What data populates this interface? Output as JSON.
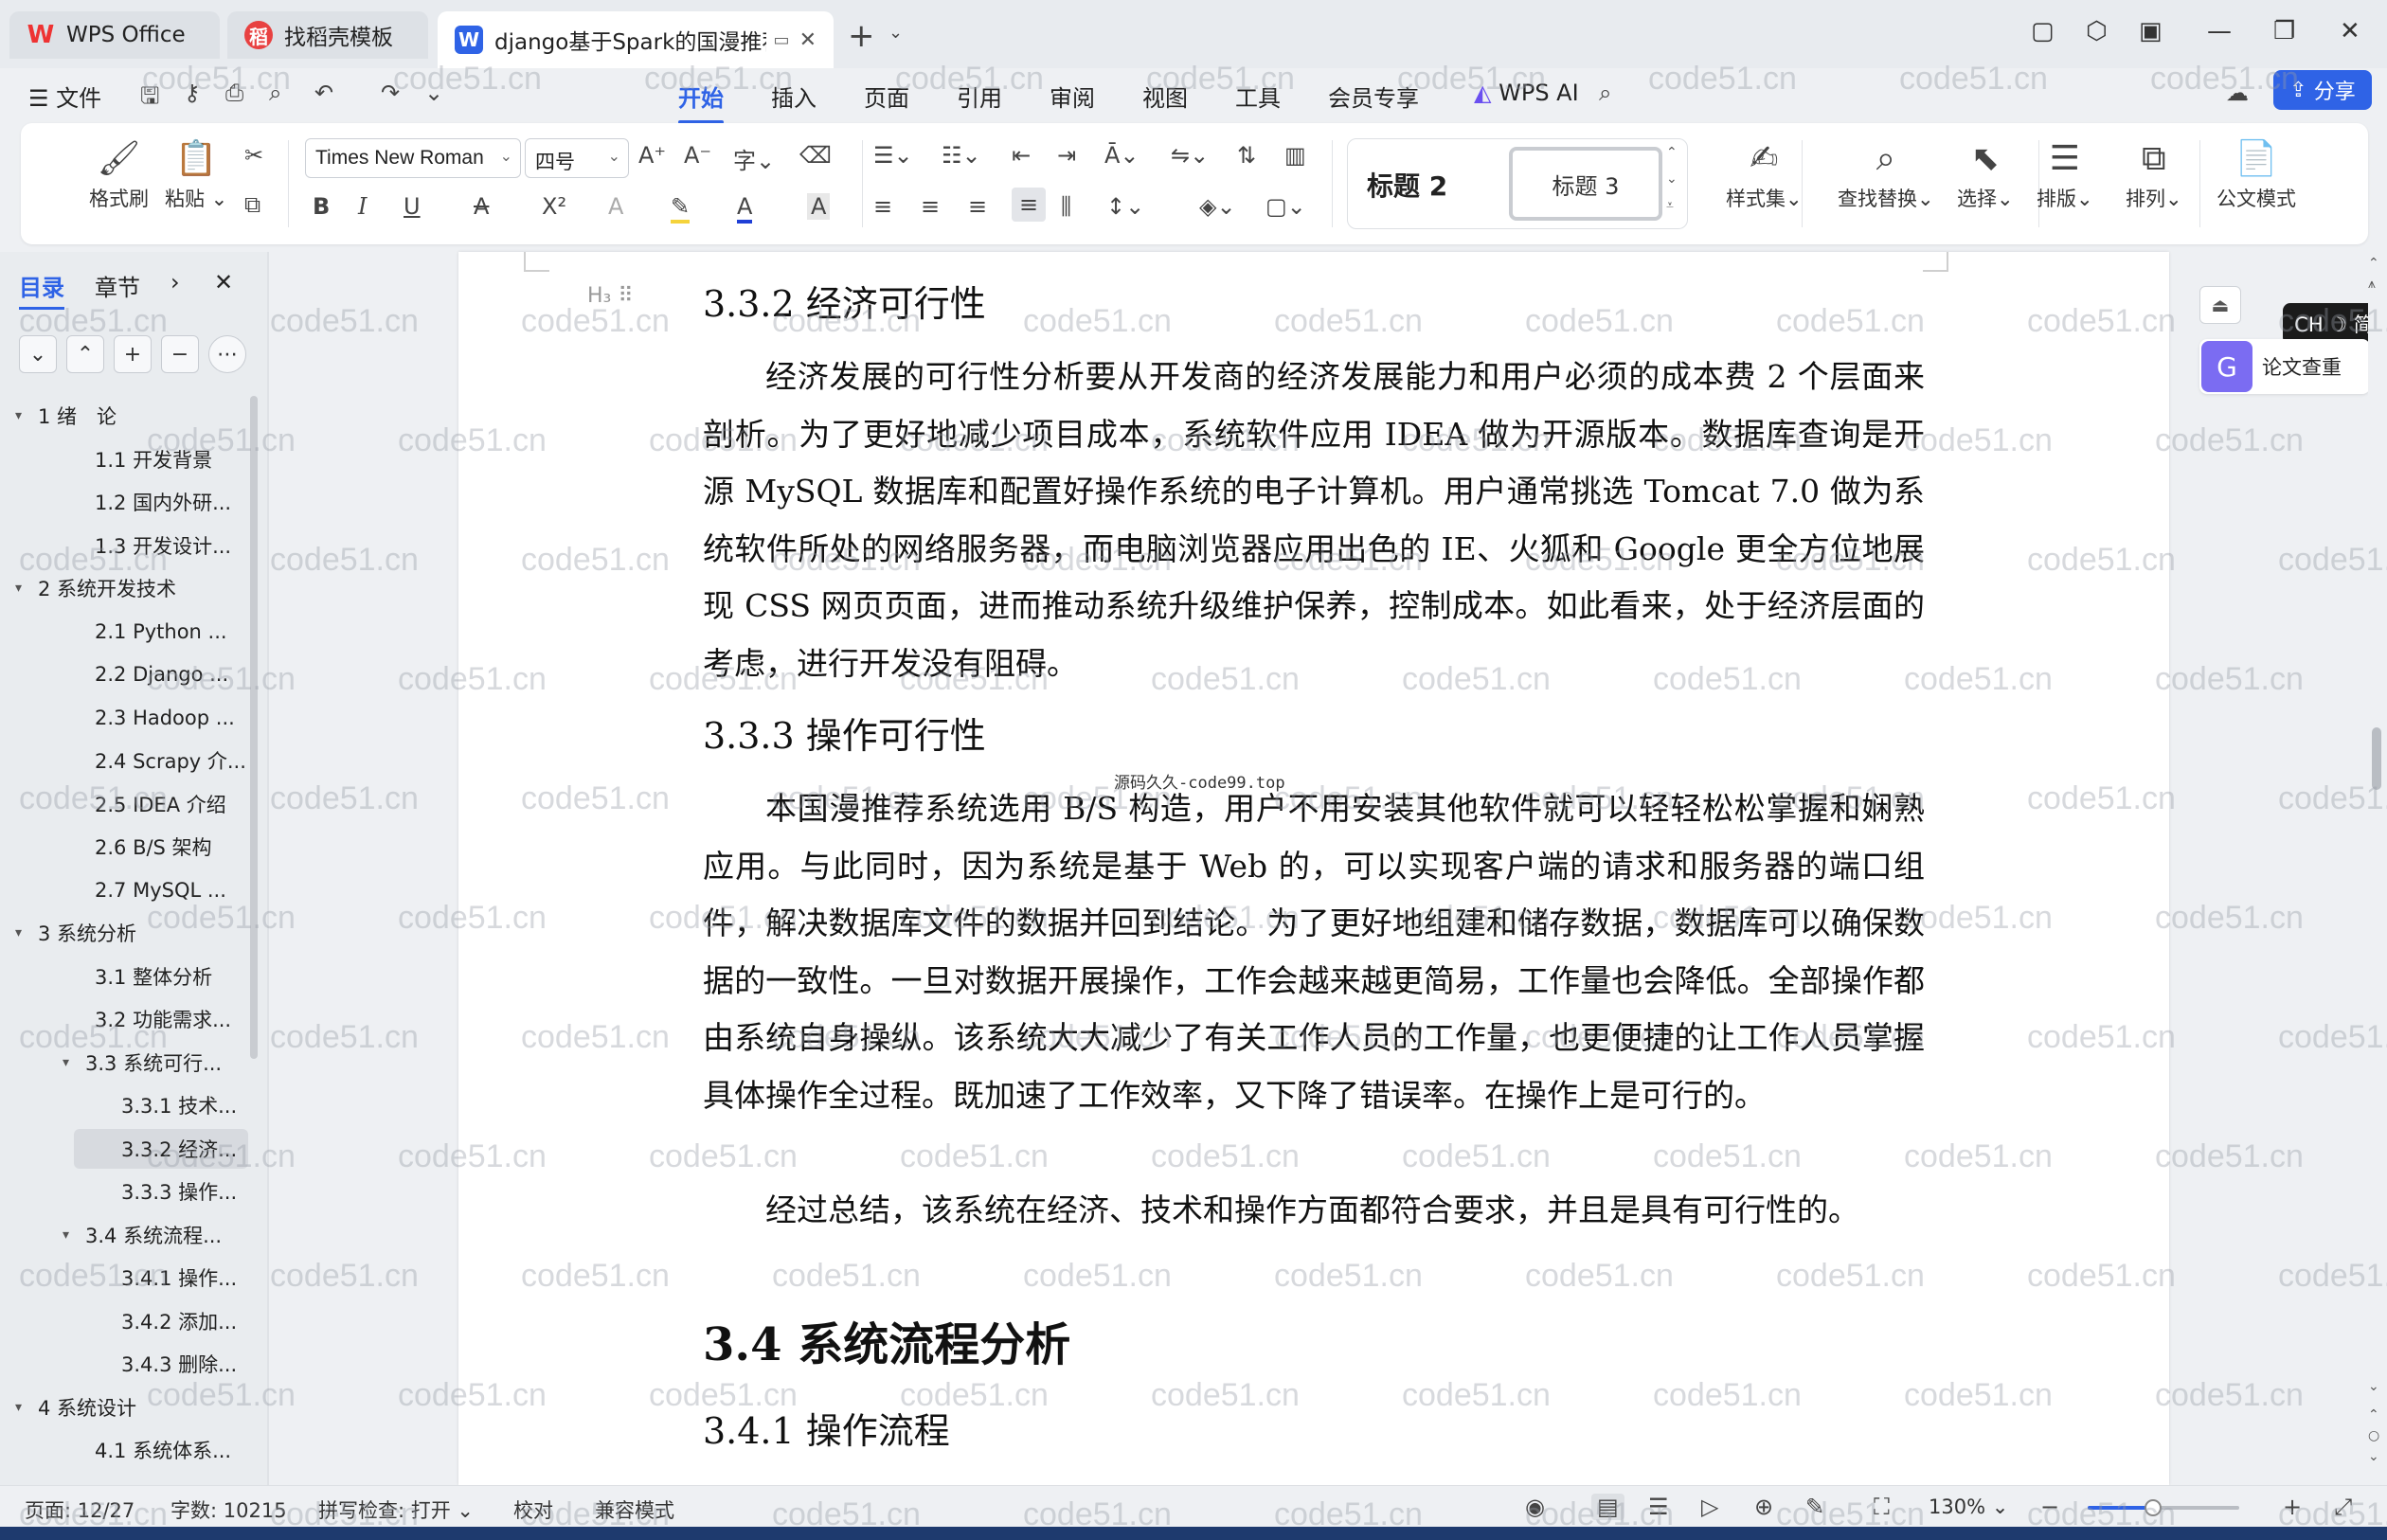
{
  "tabs": [
    {
      "label": "WPS Office",
      "icon": "wps-logo-icon"
    },
    {
      "label": "找稻壳模板",
      "icon": "docer-icon"
    },
    {
      "label": "django基于Spark的国漫推荐",
      "icon": "word-doc-icon",
      "active": true
    }
  ],
  "menu": {
    "file": "文件",
    "items": [
      "开始",
      "插入",
      "页面",
      "引用",
      "审阅",
      "视图",
      "工具",
      "会员专享"
    ],
    "active": "开始",
    "wps_ai": "WPS AI",
    "share": "分享"
  },
  "ribbon": {
    "format_painter": "格式刷",
    "paste": "粘贴",
    "font_name": "Times New Roman",
    "font_size": "四号",
    "style_heading2": "标题 2",
    "style_heading3": "标题 3",
    "style_set": "样式集",
    "find_replace": "查找替换",
    "select": "选择",
    "layout": "排版",
    "arrange": "排列",
    "official_mode": "公文模式",
    "bold": "B",
    "italic": "I",
    "underline": "U",
    "strike": "A",
    "superscript": "X²",
    "font_color": "A",
    "char_shading": "A"
  },
  "nav": {
    "tab_toc": "目录",
    "tab_chapter": "章节",
    "items": [
      {
        "label": "1 绪　论",
        "level": 0,
        "expanded": true
      },
      {
        "label": "1.1 开发背景",
        "level": 1
      },
      {
        "label": "1.2 国内外研...",
        "level": 1
      },
      {
        "label": "1.3 开发设计...",
        "level": 1
      },
      {
        "label": "2 系统开发技术",
        "level": 0,
        "expanded": true
      },
      {
        "label": "2.1 Python ...",
        "level": 1
      },
      {
        "label": "2.2 Django ...",
        "level": 1
      },
      {
        "label": "2.3 Hadoop ...",
        "level": 1
      },
      {
        "label": "2.4 Scrapy 介...",
        "level": 1
      },
      {
        "label": "2.5 IDEA 介绍",
        "level": 1
      },
      {
        "label": "2.6 B/S 架构",
        "level": 1
      },
      {
        "label": "2.7 MySQL ...",
        "level": 1
      },
      {
        "label": "3 系统分析",
        "level": 0,
        "expanded": true
      },
      {
        "label": "3.1 整体分析",
        "level": 1
      },
      {
        "label": "3.2 功能需求...",
        "level": 1
      },
      {
        "label": "3.3  系统可行...",
        "level": 1,
        "expanded": true
      },
      {
        "label": "3.3.1 技术...",
        "level": 2
      },
      {
        "label": "3.3.2 经济...",
        "level": 2,
        "selected": true
      },
      {
        "label": "3.3.3 操作...",
        "level": 2
      },
      {
        "label": "3.4 系统流程...",
        "level": 1,
        "expanded": true
      },
      {
        "label": "3.4.1 操作...",
        "level": 2
      },
      {
        "label": "3.4.2 添加...",
        "level": 2
      },
      {
        "label": "3.4.3 删除...",
        "level": 2
      },
      {
        "label": "4  系统设计",
        "level": 0,
        "expanded": true
      },
      {
        "label": "4.1  系统体系...",
        "level": 1
      }
    ]
  },
  "document": {
    "h_332": "3.3.2 经济可行性",
    "p1": "经济发展的可行性分析要从开发商的经济发展能力和用户必须的成本费 2 个层面来剖析。为了更好地减少项目成本，系统软件应用 IDEA 做为开源版本。数据库查询是开源 MySQL 数据库和配置好操作系统的电子计算机。用户通常挑选 Tomcat 7.0 做为系统软件所处的网络服务器，而电脑浏览器应用出色的 IE、火狐和 Google 更全方位地展现 CSS 网页页面，进而推动系统升级维护保养，控制成本。如此看来，处于经济层面的考虑，进行开发没有阻碍。",
    "h_333": "3.3.3 操作可行性",
    "note": "源码久久-code99.top",
    "p2": "本国漫推荐系统选用 B/S 构造，用户不用安装其他软件就可以轻轻松松掌握和娴熟应用。与此同时，因为系统是基于 Web 的，可以实现客户端的请求和服务器的端口组件，解决数据库文件的数据并回到结论。为了更好地组建和储存数据，数据库可以确保数据的一致性。一旦对数据开展操作，工作会越来越更简易，工作量也会降低。全部操作都由系统自身操纵。该系统大大减少了有关工作人员的工作量，也更便捷的让工作人员掌握具体操作全过程。既加速了工作效率，又下降了错误率。在操作上是可行的。",
    "p3": "经过总结，该系统在经济、技术和操作方面都符合要求，并且是具有可行性的。",
    "h_34": "3.4 系统流程分析",
    "h_341": "3.4.1 操作流程"
  },
  "side": {
    "ime": "CH ☽ 简",
    "paper_check": "论文查重"
  },
  "status": {
    "page": "页面: 12/27",
    "words": "字数: 10215",
    "spell": "拼写检查: 打开",
    "proof": "校对",
    "compat": "兼容模式",
    "zoom": "130%",
    "zoom_fraction": 0.43
  },
  "watermark": "code51.cn",
  "colors": {
    "accent": "#2f63e6",
    "wps_red": "#e33333"
  }
}
